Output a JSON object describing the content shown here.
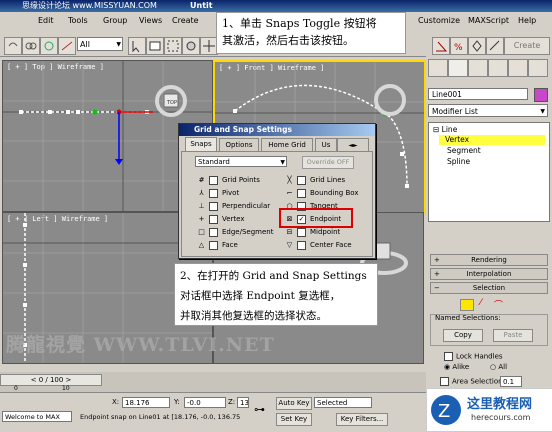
{
  "watermark_top": "思缘设计论坛 www.MISSYUAN.COM",
  "window_title": "Untit",
  "menu": [
    "Edit",
    "Tools",
    "Group",
    "Views",
    "Create",
    "Customize",
    "MAXScript",
    "Help"
  ],
  "toolbar": {
    "selection_filter": "All",
    "snap_count": "3",
    "create_label": "Create"
  },
  "viewports": {
    "top": "[ + ] Top ] Wireframe ]",
    "front": "[ + ] Front ] Wireframe ]",
    "left": "[ + ] Left ] Wireframe ]",
    "top_cube_label": "TOP"
  },
  "dialog": {
    "title": "Grid and Snap Settings",
    "tabs": [
      "Snaps",
      "Options",
      "Home Grid",
      "Us"
    ],
    "preset": "Standard",
    "override": "Override OFF",
    "left_col": [
      {
        "label": "Grid Points",
        "checked": false
      },
      {
        "label": "Pivot",
        "checked": false
      },
      {
        "label": "Perpendicular",
        "checked": false
      },
      {
        "label": "Vertex",
        "checked": false
      },
      {
        "label": "Edge/Segment",
        "checked": false
      },
      {
        "label": "Face",
        "checked": false
      }
    ],
    "right_col": [
      {
        "label": "Grid Lines",
        "checked": false
      },
      {
        "label": "Bounding Box",
        "checked": false
      },
      {
        "label": "Tangent",
        "checked": false
      },
      {
        "label": "Endpoint",
        "checked": true
      },
      {
        "label": "Midpoint",
        "checked": false
      },
      {
        "label": "Center Face",
        "checked": false
      }
    ]
  },
  "callout1": {
    "line1": "1、单击 Snaps Toggle 按钮将",
    "line2": "其激活，然后右击该按钮。"
  },
  "callout2": {
    "line1": "2、在打开的 Grid and Snap Settings",
    "line2": "对话框中选择 Endpoint 复选框，",
    "line3": "并取消其他复选框的选择状态。"
  },
  "watermark_bottom": "腾龍視覺 WWW.TLVI.NET",
  "command_panel": {
    "object_name": "Line001",
    "modifier_list": "Modifier List",
    "stack": [
      "Line",
      "Vertex",
      "Segment",
      "Spline"
    ],
    "rollouts": {
      "rendering": "Rendering",
      "interpolation": "Interpolation",
      "selection": "Selection"
    },
    "named_selections": "Named Selections:",
    "copy": "Copy",
    "paste": "Paste",
    "lock_handles": "Lock Handles",
    "alike": "Alike",
    "all": "All",
    "area_selection": "Area Selection:",
    "area_value": "0.1"
  },
  "timeline": {
    "frame": "0 / 100",
    "tick0": "0",
    "tick10": "10"
  },
  "status": {
    "welcome": "Welcome to MAX",
    "message": "Endpoint snap on Line01 at [18.176, -0.0, 136.75",
    "x_label": "X:",
    "x": "18.176",
    "y_label": "Y:",
    "y": "-0.0",
    "z_label": "Z:",
    "z": "136.75",
    "autokey": "Auto Key",
    "setkey": "Set Key",
    "selected": "Selected",
    "keyfilters": "Key Filters..."
  },
  "site_logo": {
    "text1": "这里教程网",
    "text2": "herecours.com"
  }
}
